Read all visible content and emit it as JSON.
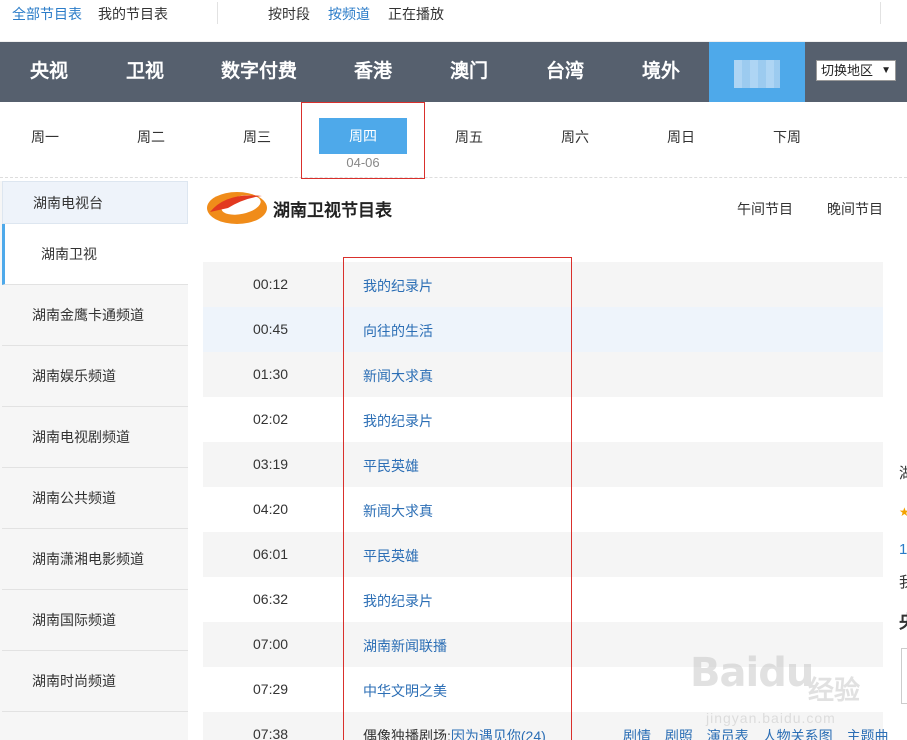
{
  "topbar": {
    "all_guide": "全部节目表",
    "my_guide": "我的节目表",
    "by_time": "按时段",
    "by_channel": "按频道",
    "now_playing": "正在播放"
  },
  "regions": {
    "items": [
      "央视",
      "卫视",
      "数字付费",
      "香港",
      "澳门",
      "台湾",
      "境外"
    ],
    "switch_label": "切换地区",
    "switch_arrow": "▼"
  },
  "days": {
    "items": [
      "周一",
      "周二",
      "周三",
      "周四",
      "周五",
      "周六",
      "周日",
      "下周"
    ],
    "selected": "周四",
    "selected_date": "04-06"
  },
  "sidebar": {
    "group": "湖南电视台",
    "channels": [
      "湖南卫视",
      "湖南金鹰卡通频道",
      "湖南娱乐频道",
      "湖南电视剧频道",
      "湖南公共频道",
      "湖南潇湘电影频道",
      "湖南国际频道",
      "湖南时尚频道"
    ],
    "active": "湖南卫视"
  },
  "channel": {
    "title": "湖南卫视节目表",
    "noon": "午间节目",
    "evening": "晚间节目"
  },
  "schedule": [
    {
      "time": "00:12",
      "program": "我的纪录片"
    },
    {
      "time": "00:45",
      "program": "向往的生活"
    },
    {
      "time": "01:30",
      "program": "新闻大求真"
    },
    {
      "time": "02:02",
      "program": "我的纪录片"
    },
    {
      "time": "03:19",
      "program": "平民英雄"
    },
    {
      "time": "04:20",
      "program": "新闻大求真"
    },
    {
      "time": "06:01",
      "program": "平民英雄"
    },
    {
      "time": "06:32",
      "program": "我的纪录片"
    },
    {
      "time": "07:00",
      "program": "湖南新闻联播"
    },
    {
      "time": "07:29",
      "program": "中华文明之美"
    },
    {
      "time": "07:38",
      "program_prefix": "偶像独播剧场:",
      "program": "因为遇见你(24)",
      "links": [
        "剧情",
        "剧照",
        "演员表",
        "人物关系图",
        "主题曲"
      ]
    }
  ],
  "right_fragments": [
    "湖",
    "1",
    "我",
    "央"
  ],
  "watermark": {
    "brand": "Baidu",
    "cn": "经验",
    "url": "jingyan.baidu.com"
  },
  "colors": {
    "accent": "#4ea9ea",
    "nav_bg": "#56606e",
    "link": "#2b6eb5",
    "highlight_box": "#d9302c"
  }
}
